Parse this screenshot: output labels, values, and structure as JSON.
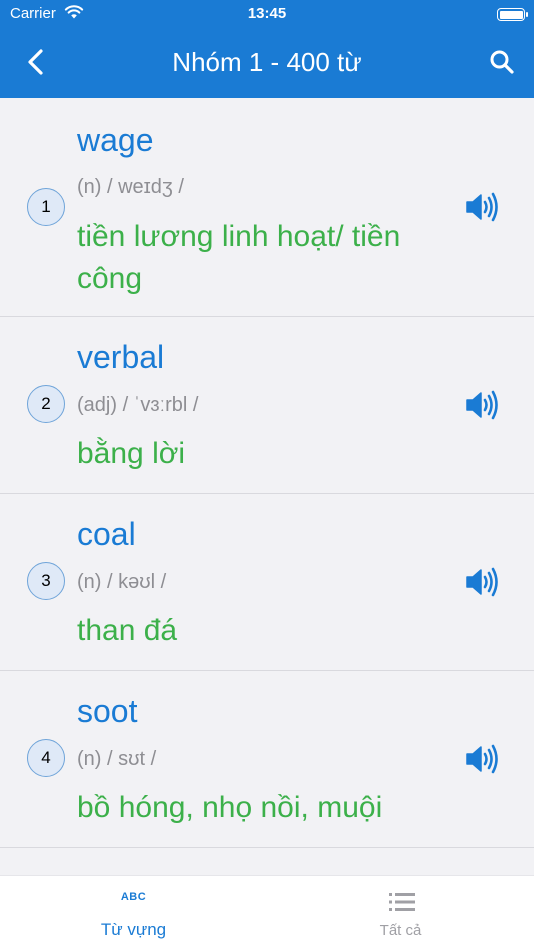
{
  "status_bar": {
    "carrier": "Carrier",
    "time": "13:45"
  },
  "header": {
    "title": "Nhóm 1 - 400 từ"
  },
  "words": [
    {
      "number": "1",
      "word": "wage",
      "pronunciation": "(n) / weɪdʒ /",
      "meaning": "tiền lương linh hoạt/ tiền công"
    },
    {
      "number": "2",
      "word": "verbal",
      "pronunciation": "(adj) / ˈvɜːrbl /",
      "meaning": "bằng lời"
    },
    {
      "number": "3",
      "word": "coal",
      "pronunciation": "(n) / kəʊl /",
      "meaning": "than đá"
    },
    {
      "number": "4",
      "word": "soot",
      "pronunciation": "(n) / sʊt /",
      "meaning": "bồ hóng, nhọ nồi, muội"
    }
  ],
  "tabs": [
    {
      "icon_text": "ABC",
      "label": "Từ vựng",
      "active": true
    },
    {
      "icon": "list-icon",
      "label": "Tất cả",
      "active": false
    }
  ],
  "colors": {
    "accent": "#1a7bd4",
    "meaning": "#3cb04a",
    "muted": "#8e8e93",
    "background": "#f2f2f5"
  }
}
